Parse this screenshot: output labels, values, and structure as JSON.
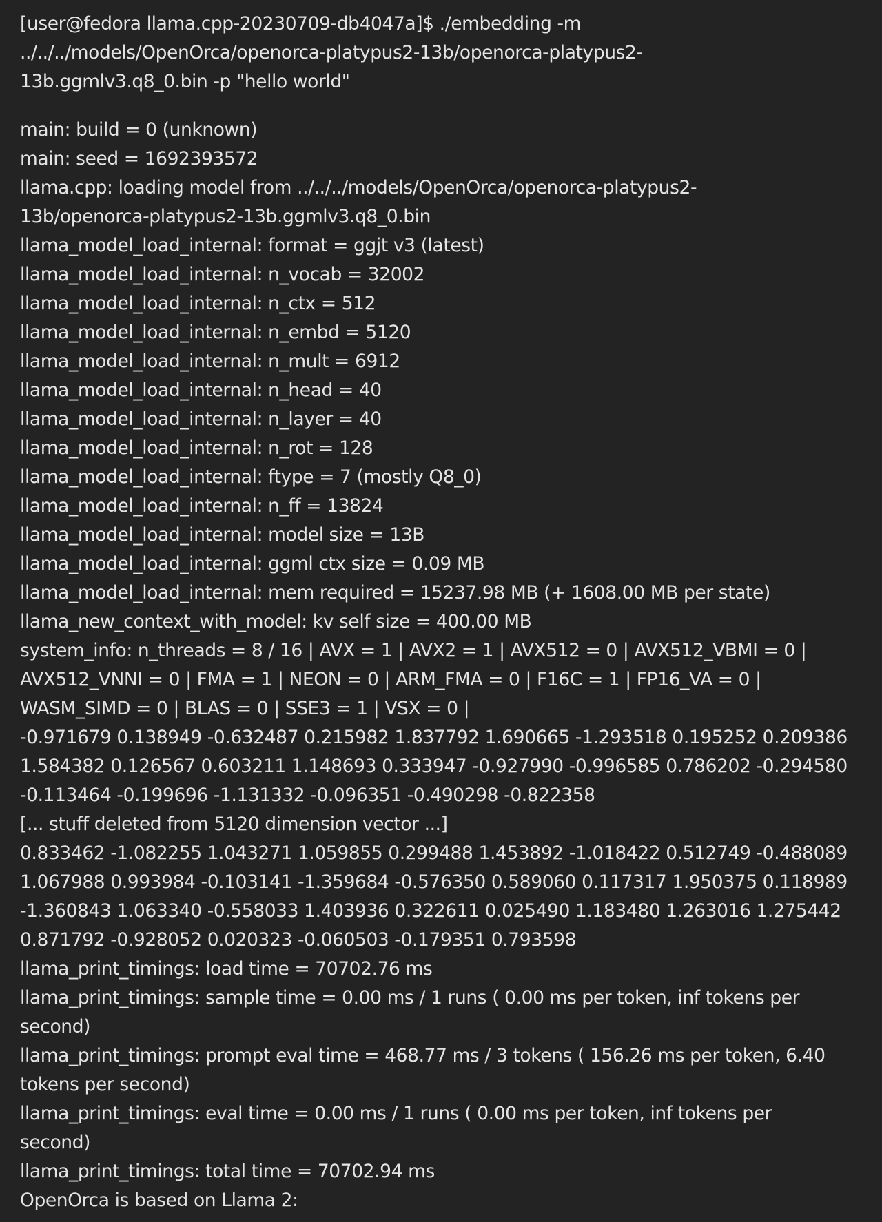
{
  "terminal": {
    "background": "#232323",
    "foreground": "#e4e4e4",
    "prompt_lines": [
      "[user@fedora llama.cpp-20230709-db4047a]$ ./embedding -m",
      "../../../models/OpenOrca/openorca-platypus2-13b/openorca-platypus2-",
      "13b.ggmlv3.q8_0.bin -p \"hello world\""
    ],
    "output_lines": [
      "main: build = 0 (unknown)",
      "main: seed = 1692393572",
      "llama.cpp: loading model from ../../../models/OpenOrca/openorca-platypus2-",
      "13b/openorca-platypus2-13b.ggmlv3.q8_0.bin",
      "llama_model_load_internal: format = ggjt v3 (latest)",
      "llama_model_load_internal: n_vocab = 32002",
      "llama_model_load_internal: n_ctx = 512",
      "llama_model_load_internal: n_embd = 5120",
      "llama_model_load_internal: n_mult = 6912",
      "llama_model_load_internal: n_head = 40",
      "llama_model_load_internal: n_layer = 40",
      "llama_model_load_internal: n_rot = 128",
      "llama_model_load_internal: ftype = 7 (mostly Q8_0)",
      "llama_model_load_internal: n_ff = 13824",
      "llama_model_load_internal: model size = 13B",
      "llama_model_load_internal: ggml ctx size = 0.09 MB",
      "llama_model_load_internal: mem required = 15237.98 MB (+ 1608.00 MB per state)",
      "llama_new_context_with_model: kv self size = 400.00 MB",
      "system_info: n_threads = 8 / 16 | AVX = 1 | AVX2 = 1 | AVX512 = 0 | AVX512_VBMI = 0 |",
      "AVX512_VNNI = 0 | FMA = 1 | NEON = 0 | ARM_FMA = 0 | F16C = 1 | FP16_VA = 0 |",
      "WASM_SIMD = 0 | BLAS = 0 | SSE3 = 1 | VSX = 0 |",
      "-0.971679 0.138949 -0.632487 0.215982 1.837792 1.690665 -1.293518 0.195252 0.209386",
      "1.584382 0.126567 0.603211 1.148693 0.333947 -0.927990 -0.996585 0.786202 -0.294580",
      "-0.113464 -0.199696 -1.131332 -0.096351 -0.490298 -0.822358",
      "[... stuff deleted from 5120 dimension vector ...]",
      "0.833462 -1.082255 1.043271 1.059855 0.299488 1.453892 -1.018422 0.512749 -0.488089",
      "1.067988 0.993984 -0.103141 -1.359684 -0.576350 0.589060 0.117317 1.950375 0.118989",
      "-1.360843 1.063340 -0.558033 1.403936 0.322611 0.025490 1.183480 1.263016 1.275442",
      "0.871792 -0.928052 0.020323 -0.060503 -0.179351 0.793598",
      "llama_print_timings: load time = 70702.76 ms",
      "llama_print_timings: sample time = 0.00 ms / 1 runs ( 0.00 ms per token, inf tokens per",
      "second)",
      "llama_print_timings: prompt eval time = 468.77 ms / 3 tokens ( 156.26 ms per token, 6.40",
      "tokens per second)",
      "llama_print_timings: eval time = 0.00 ms / 1 runs ( 0.00 ms per token, inf tokens per",
      "second)",
      "llama_print_timings: total time = 70702.94 ms",
      "OpenOrca is based on Llama 2:"
    ]
  }
}
